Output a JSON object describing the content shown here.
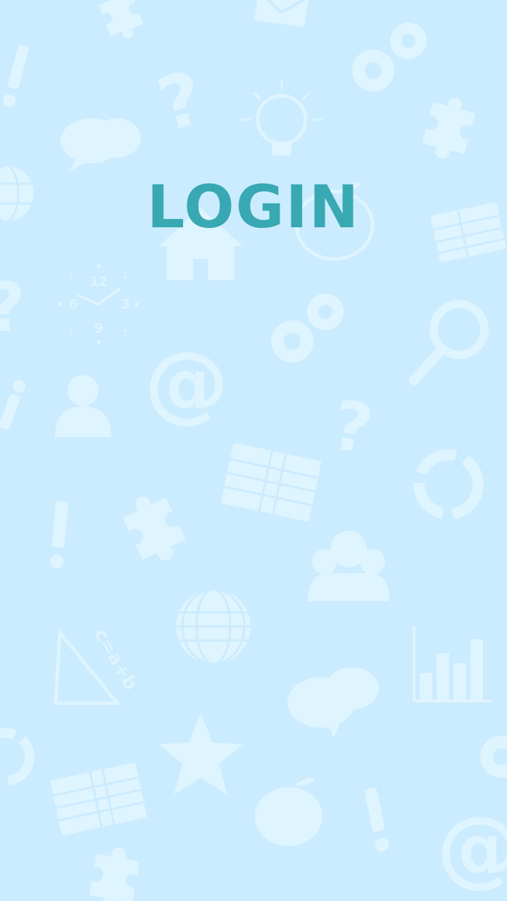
{
  "screen": {
    "title": "LOGIN"
  },
  "background": {
    "color": "#cbebfe",
    "pattern_color": "#def4ff",
    "icons": [
      "puzzle-icon",
      "envelope-icon",
      "exclamation-icon",
      "gears-icon",
      "question-icon",
      "lightbulb-icon",
      "chat-bubbles-icon",
      "globe-icon",
      "apple-icon",
      "house-icon",
      "spreadsheet-icon",
      "clock-icon",
      "magnifier-icon",
      "at-sign-icon",
      "user-icon",
      "refresh-icon",
      "group-icon",
      "triangle-formula-icon",
      "star-icon",
      "bar-chart-icon"
    ],
    "clock_numbers": [
      "12",
      "3",
      "6",
      "9"
    ],
    "formula_text": "c=a+b"
  },
  "colors": {
    "title": "#38a9b3"
  }
}
